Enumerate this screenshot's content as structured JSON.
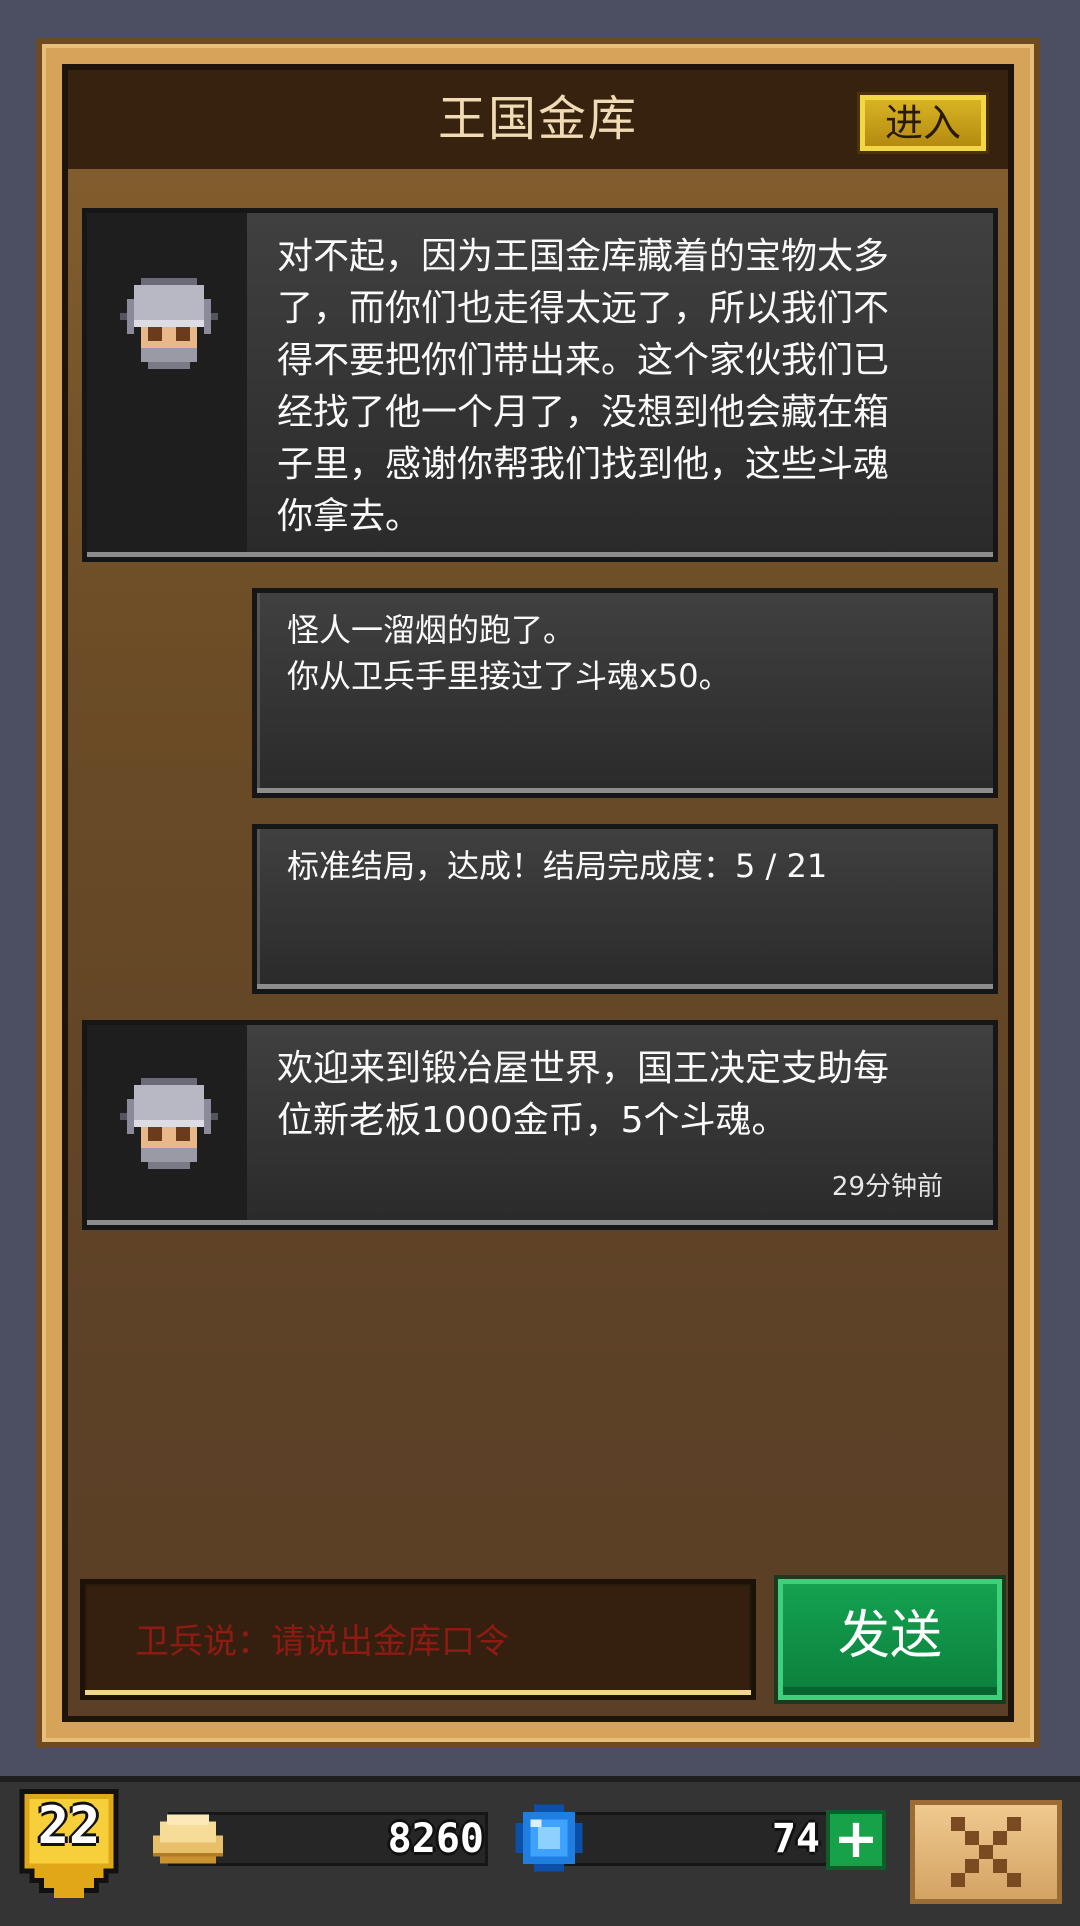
{
  "header": {
    "title": "王国金库",
    "enter_label": "进入"
  },
  "messages": [
    {
      "type": "npc",
      "avatar": "knight-helmet-icon",
      "text": "对不起，因为王国金库藏着的宝物太多\n了，而你们也走得太远了，所以我们不\n得不要把你们带出来。这个家伙我们已\n经找了他一个月了，没想到他会藏在箱\n子里，感谢你帮我们找到他，这些斗魂\n你拿去。"
    },
    {
      "type": "system",
      "text": "怪人一溜烟的跑了。\n你从卫兵手里接过了斗魂x50。"
    },
    {
      "type": "system",
      "text": "标准结局，达成！结局完成度：5 / 21"
    },
    {
      "type": "npc",
      "avatar": "knight-helmet-icon",
      "text": "欢迎来到锻冶屋世界，国王决定支助每\n位新老板1000金币，5个斗魂。",
      "time": "29分钟前"
    }
  ],
  "input": {
    "placeholder": "卫兵说：请说出金库口令",
    "send_label": "发送"
  },
  "status": {
    "level": "22",
    "gold": "8260",
    "gems": "74",
    "gold_icon": "coin-stack-icon",
    "gem_icon": "blue-gem-icon",
    "plus_icon": "plus-icon",
    "close_icon": "close-icon"
  },
  "colors": {
    "panel_frame": "#d6a35a",
    "panel_bg": "#6b4c26",
    "bubble_bg": "#333333",
    "send_green": "#0f8f44",
    "enter_gold": "#c9a01a",
    "placeholder_red": "#8e1a14"
  }
}
